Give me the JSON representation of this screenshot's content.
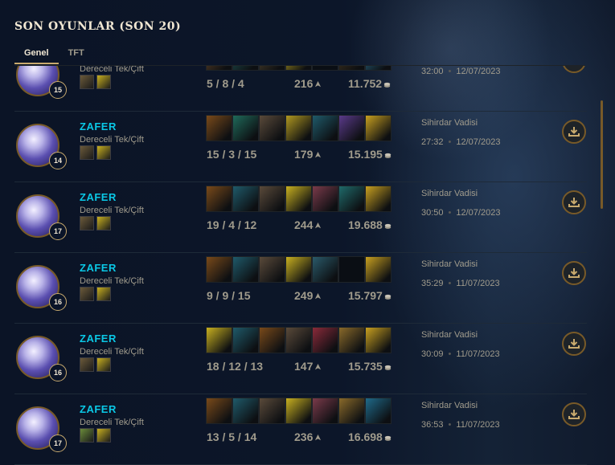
{
  "title": "SON OYUNLAR (SON 20)",
  "tabs": [
    {
      "label": "Genel",
      "active": true
    },
    {
      "label": "TFT",
      "active": false
    }
  ],
  "matches": [
    {
      "level": "15",
      "player": "",
      "queue": "Dereceli Tek/Çift",
      "kda": "5 / 8 / 4",
      "cs": "216",
      "gold": "11.752",
      "mode": "",
      "duration": "32:00",
      "date": "12/07/2023",
      "items": [
        "#6b4a2a",
        "#1f5a5a",
        "#5a4a30",
        "#c8b020",
        "",
        "#4a3a20",
        "#2a7090"
      ],
      "spells": [
        "#6b5a3a",
        "#c8b020"
      ]
    },
    {
      "level": "14",
      "player": "ZAFER",
      "queue": "Dereceli Tek/Çift",
      "kda": "15 / 3 / 15",
      "cs": "179",
      "gold": "15.195",
      "mode": "Sihirdar Vadisi",
      "duration": "27:32",
      "date": "12/07/2023",
      "items": [
        "#7a4a1a",
        "#1f6a5a",
        "#5a4a3a",
        "#b09820",
        "#1f5a6a",
        "#5a3a8a",
        "#c8a020"
      ],
      "spells": [
        "#6b5a3a",
        "#c8b020"
      ]
    },
    {
      "level": "17",
      "player": "ZAFER",
      "queue": "Dereceli Tek/Çift",
      "kda": "19 / 4 / 12",
      "cs": "244",
      "gold": "19.688",
      "mode": "Sihirdar Vadisi",
      "duration": "30:50",
      "date": "12/07/2023",
      "items": [
        "#7a4a1a",
        "#1f5a6a",
        "#5a4a3a",
        "#c8b020",
        "#7a3a4a",
        "#1f6a6a",
        "#c8a020"
      ],
      "spells": [
        "#6b5a3a",
        "#c8b020"
      ]
    },
    {
      "level": "16",
      "player": "ZAFER",
      "queue": "Dereceli Tek/Çift",
      "kda": "9 / 9 / 15",
      "cs": "249",
      "gold": "15.797",
      "mode": "Sihirdar Vadisi",
      "duration": "35:29",
      "date": "11/07/2023",
      "items": [
        "#7a4a1a",
        "#1f5a6a",
        "#5a4a3a",
        "#c8b020",
        "#2a5a6a",
        "",
        "#c8a020"
      ],
      "spells": [
        "#6b5a3a",
        "#c8b020"
      ]
    },
    {
      "level": "16",
      "player": "ZAFER",
      "queue": "Dereceli Tek/Çift",
      "kda": "18 / 12 / 13",
      "cs": "147",
      "gold": "15.735",
      "mode": "Sihirdar Vadisi",
      "duration": "30:09",
      "date": "11/07/2023",
      "items": [
        "#c8b020",
        "#1f5a6a",
        "#7a4a1a",
        "#5a4a3a",
        "#8a2a3a",
        "#8a6a2a",
        "#c8a020"
      ],
      "spells": [
        "#6b5a3a",
        "#c8b020"
      ]
    },
    {
      "level": "17",
      "player": "ZAFER",
      "queue": "Dereceli Tek/Çift",
      "kda": "13 / 5 / 14",
      "cs": "236",
      "gold": "16.698",
      "mode": "Sihirdar Vadisi",
      "duration": "36:53",
      "date": "11/07/2023",
      "items": [
        "#7a4a1a",
        "#1f5a6a",
        "#5a4a3a",
        "#c8b020",
        "#7a3a4a",
        "#8a6a2a",
        "#1f6a8a"
      ],
      "spells": [
        "#6a8a3a",
        "#c8b020"
      ]
    }
  ],
  "icons": {
    "download": "download-icon",
    "cs": "minion-icon",
    "gold": "gold-icon"
  },
  "colors": {
    "accent": "#c8aa6e",
    "name": "#0ac8e6",
    "bg": "#0a1428"
  }
}
